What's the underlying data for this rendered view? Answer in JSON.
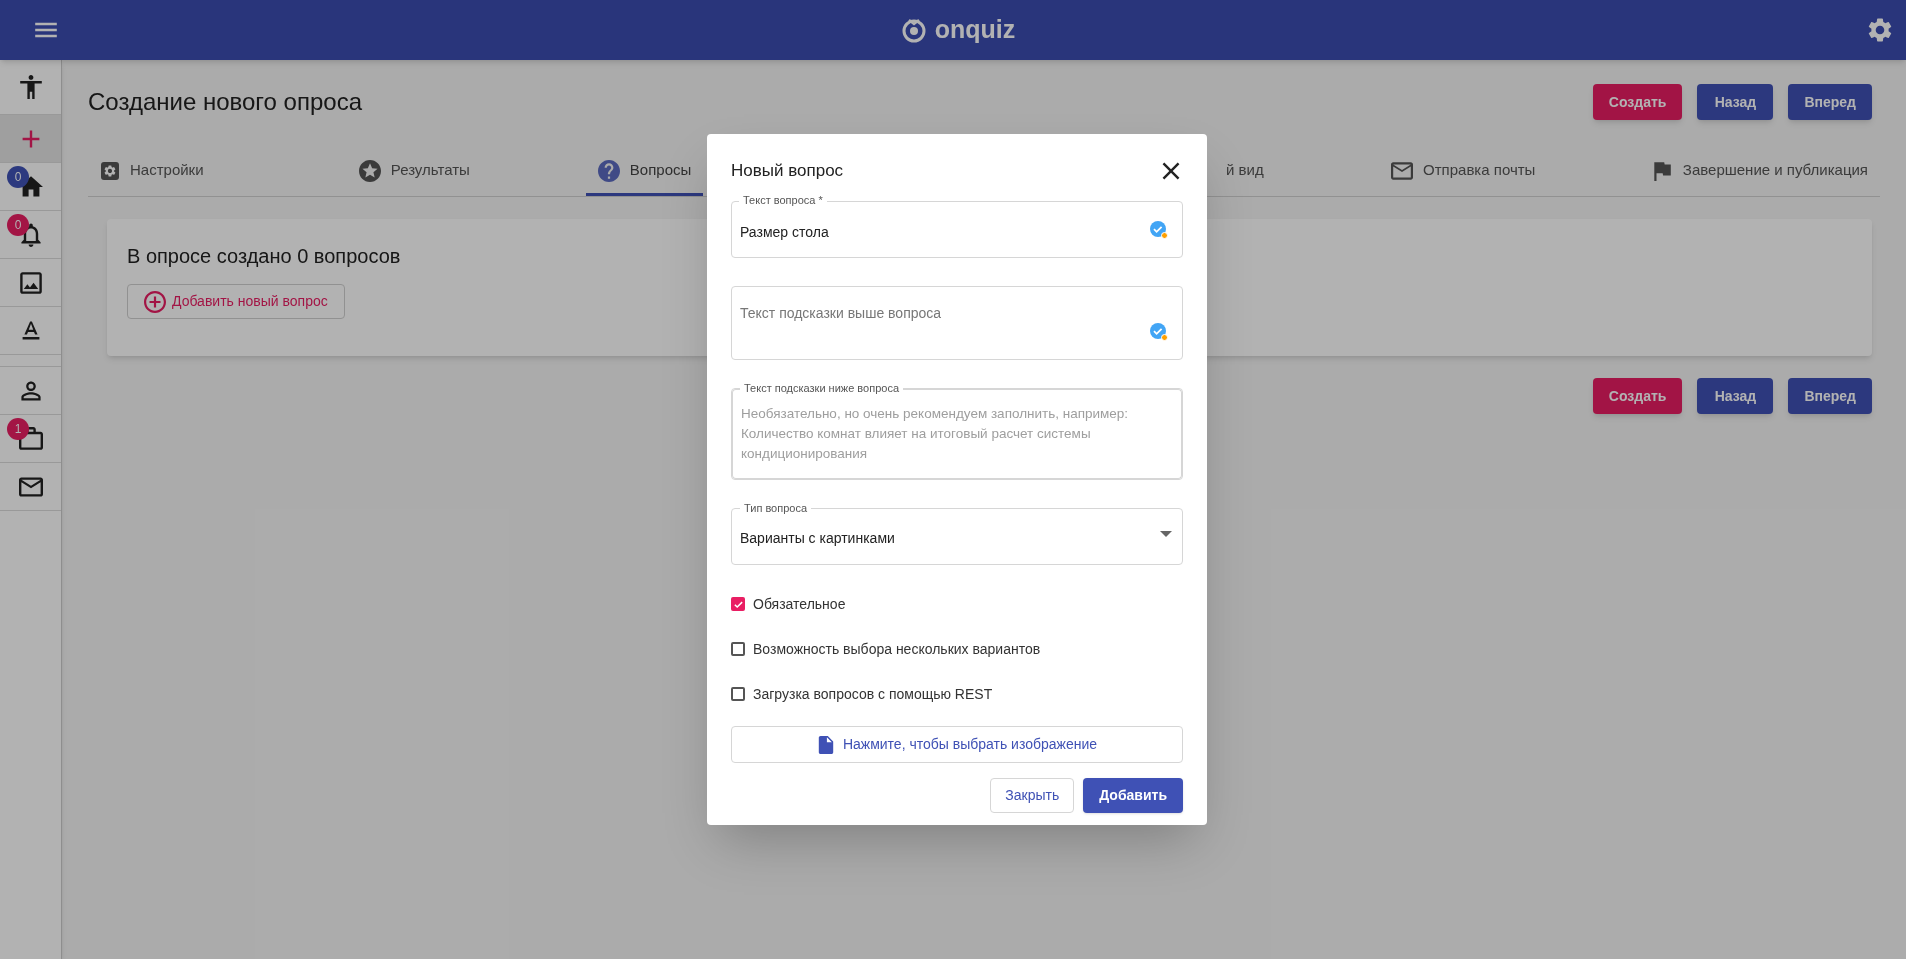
{
  "header": {
    "logo_text": "onquiz"
  },
  "sidebar": {
    "groups": [
      {
        "items": [
          {
            "kind": "accessibility",
            "selected": false
          },
          {
            "kind": "add",
            "selected": true
          },
          {
            "kind": "home",
            "selected": false,
            "badge": "0",
            "color": "#2c397f"
          },
          {
            "kind": "bell",
            "selected": false,
            "badge": "0",
            "color": "#a31545"
          },
          {
            "kind": "image",
            "selected": false
          },
          {
            "kind": "text",
            "selected": false
          }
        ]
      },
      {
        "items": [
          {
            "kind": "person",
            "selected": false
          },
          {
            "kind": "briefcase",
            "selected": false,
            "badge": "1",
            "color": "#a31545"
          },
          {
            "kind": "mail",
            "selected": false
          }
        ]
      }
    ]
  },
  "page": {
    "title": "Создание нового опроса",
    "actions": [
      {
        "label": "Создать",
        "kind": "accent"
      },
      {
        "label": "Назад",
        "kind": "primary"
      },
      {
        "label": "Вперед",
        "kind": "primary"
      }
    ],
    "tabs": [
      {
        "label": "Настройки",
        "kind": "settings",
        "selected": false
      },
      {
        "label": "Результаты",
        "kind": "star",
        "selected": false
      },
      {
        "label": "Вопросы",
        "kind": "help",
        "selected": true
      },
      {
        "label": "й вид",
        "kind": "plain",
        "selected": false
      },
      {
        "label": "Отправка почты",
        "kind": "mail",
        "selected": false
      },
      {
        "label": "Завершение и публикация",
        "kind": "flag",
        "selected": false
      }
    ],
    "card": {
      "heading": "В опросе создано 0 вопросов",
      "add_button": "Добавить новый вопрос"
    },
    "bottom_actions": [
      {
        "label": "Создать",
        "kind": "accent"
      },
      {
        "label": "Назад",
        "kind": "primary"
      },
      {
        "label": "Вперед",
        "kind": "primary"
      }
    ]
  },
  "dialog": {
    "title": "Новый вопрос",
    "fields": [
      {
        "kind": "text",
        "label": "Текст вопроса *",
        "value": "Размер стола"
      },
      {
        "kind": "text",
        "placeholder": "Текст подсказки выше вопроса"
      },
      {
        "kind": "textarea",
        "label": "Текст подсказки ниже вопроса",
        "placeholder": "Необязательно, но очень рекомендуем заполнить, например: Количество комнат влияет на итоговый расчет системы кондиционирования"
      },
      {
        "kind": "select",
        "label": "Тип вопроса",
        "value": "Варианты с картинками"
      }
    ],
    "checkboxes": [
      {
        "label": "Обязательное",
        "checked": true
      },
      {
        "label": "Возможность выбора нескольких вариантов",
        "checked": false
      },
      {
        "label": "Загрузка вопросов с помощью REST",
        "checked": false
      }
    ],
    "file_button": "Нажмите, чтобы выбрать изображение",
    "buttons": [
      {
        "label": "Закрыть",
        "kind": "outlined"
      },
      {
        "label": "Добавить",
        "kind": "primary"
      }
    ]
  }
}
